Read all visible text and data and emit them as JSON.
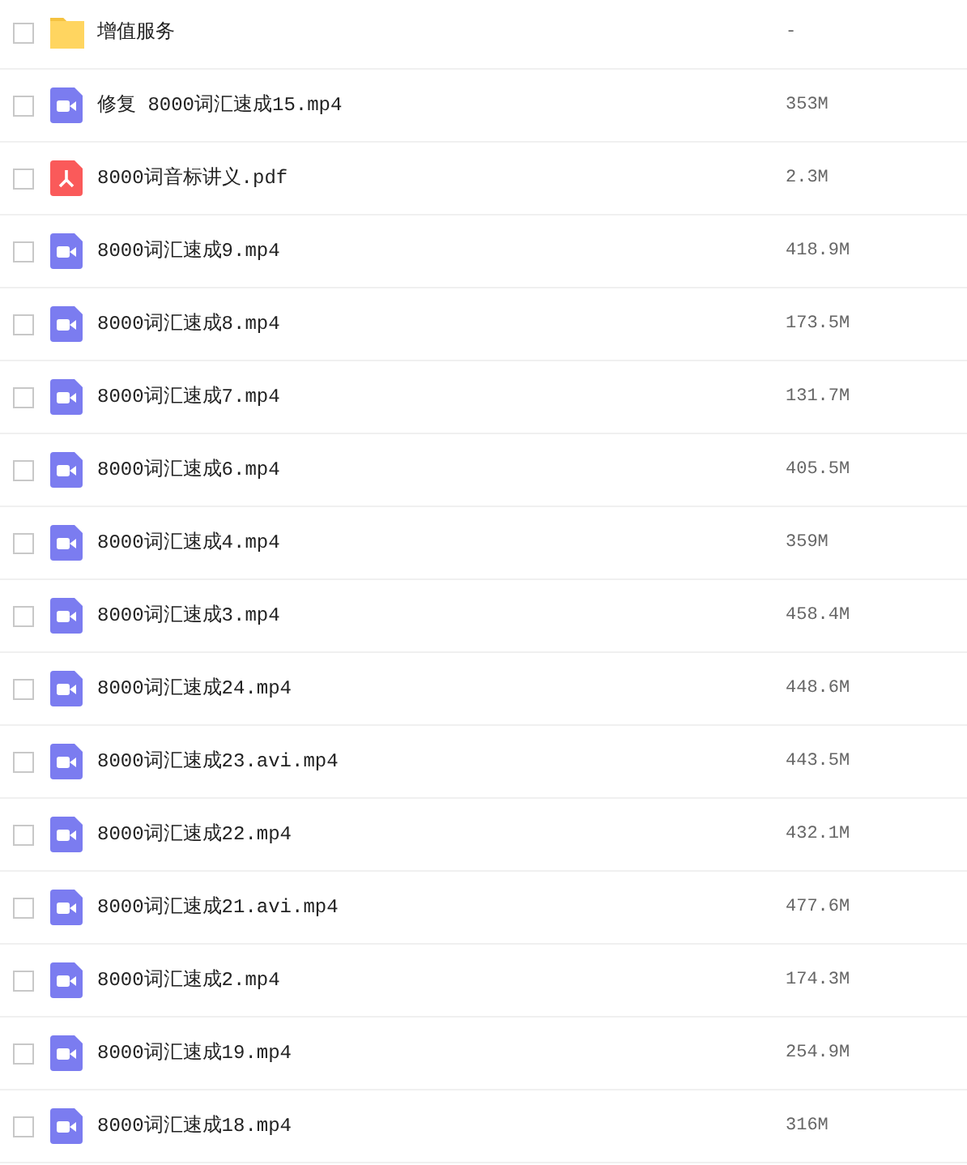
{
  "files": [
    {
      "kind": "folder",
      "name": "增值服务",
      "size": "-",
      "checked": false
    },
    {
      "kind": "video",
      "name": "修复 8000词汇速成15.mp4",
      "size": "353M",
      "checked": false
    },
    {
      "kind": "pdf",
      "name": "8000词音标讲义.pdf",
      "size": "2.3M",
      "checked": false
    },
    {
      "kind": "video",
      "name": "8000词汇速成9.mp4",
      "size": "418.9M",
      "checked": false
    },
    {
      "kind": "video",
      "name": "8000词汇速成8.mp4",
      "size": "173.5M",
      "checked": false
    },
    {
      "kind": "video",
      "name": "8000词汇速成7.mp4",
      "size": "131.7M",
      "checked": false
    },
    {
      "kind": "video",
      "name": "8000词汇速成6.mp4",
      "size": "405.5M",
      "checked": false
    },
    {
      "kind": "video",
      "name": "8000词汇速成4.mp4",
      "size": "359M",
      "checked": false
    },
    {
      "kind": "video",
      "name": "8000词汇速成3.mp4",
      "size": "458.4M",
      "checked": false
    },
    {
      "kind": "video",
      "name": "8000词汇速成24.mp4",
      "size": "448.6M",
      "checked": false
    },
    {
      "kind": "video",
      "name": "8000词汇速成23.avi.mp4",
      "size": "443.5M",
      "checked": false
    },
    {
      "kind": "video",
      "name": "8000词汇速成22.mp4",
      "size": "432.1M",
      "checked": false
    },
    {
      "kind": "video",
      "name": "8000词汇速成21.avi.mp4",
      "size": "477.6M",
      "checked": false
    },
    {
      "kind": "video",
      "name": "8000词汇速成2.mp4",
      "size": "174.3M",
      "checked": false
    },
    {
      "kind": "video",
      "name": "8000词汇速成19.mp4",
      "size": "254.9M",
      "checked": false
    },
    {
      "kind": "video",
      "name": "8000词汇速成18.mp4",
      "size": "316M",
      "checked": false
    }
  ]
}
